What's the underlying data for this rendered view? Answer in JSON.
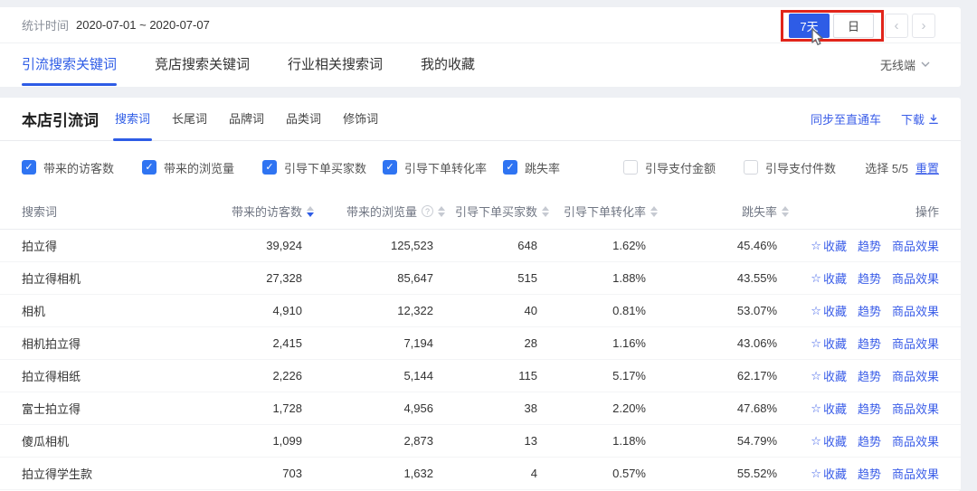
{
  "colors": {
    "accent": "#2e5ce6",
    "link": "#3a5de8",
    "checkbox": "#2f74f2",
    "annotation": "#e1251b"
  },
  "topbar": {
    "stats_label": "统计时间",
    "date_range": "2020-07-01 ~ 2020-07-07",
    "periods": [
      {
        "label": "7天",
        "active": true
      },
      {
        "label": "日",
        "active": false
      }
    ],
    "prev": "‹",
    "next": "›"
  },
  "nav_tabs": {
    "items": [
      {
        "label": "引流搜索关键词",
        "active": true
      },
      {
        "label": "竞店搜索关键词",
        "active": false
      },
      {
        "label": "行业相关搜索词",
        "active": false
      },
      {
        "label": "我的收藏",
        "active": false
      }
    ],
    "channel_label": "无线端"
  },
  "section": {
    "title": "本店引流词",
    "subtabs": [
      {
        "label": "搜索词",
        "active": true
      },
      {
        "label": "长尾词",
        "active": false
      },
      {
        "label": "品牌词",
        "active": false
      },
      {
        "label": "品类词",
        "active": false
      },
      {
        "label": "修饰词",
        "active": false
      }
    ],
    "sync_link": "同步至直通车",
    "download_link": "下载"
  },
  "filters": {
    "items": [
      {
        "label": "带来的访客数",
        "checked": true
      },
      {
        "label": "带来的浏览量",
        "checked": true
      },
      {
        "label": "引导下单买家数",
        "checked": true
      },
      {
        "label": "引导下单转化率",
        "checked": true
      },
      {
        "label": "跳失率",
        "checked": true
      },
      {
        "label": "引导支付金额",
        "checked": false
      },
      {
        "label": "引导支付件数",
        "checked": false
      }
    ],
    "selection_label": "选择 5/5",
    "reset_label": "重置",
    "check_glyph": "✓"
  },
  "table": {
    "columns": [
      {
        "key": "keyword",
        "label": "搜索词",
        "sortable": false
      },
      {
        "key": "visitors",
        "label": "带来的访客数",
        "sortable": true,
        "sort": "desc"
      },
      {
        "key": "views",
        "label": "带来的浏览量",
        "sortable": true,
        "sort": "none",
        "info": true
      },
      {
        "key": "buyers",
        "label": "引导下单买家数",
        "sortable": true,
        "sort": "none"
      },
      {
        "key": "conversion",
        "label": "引导下单转化率",
        "sortable": true,
        "sort": "none"
      },
      {
        "key": "bounce",
        "label": "跳失率",
        "sortable": true,
        "sort": "none"
      },
      {
        "key": "actions",
        "label": "操作",
        "sortable": false
      }
    ],
    "rows": [
      {
        "keyword": "拍立得",
        "visitors": "39,924",
        "views": "125,523",
        "buyers": "648",
        "conversion": "1.62%",
        "bounce": "45.46%"
      },
      {
        "keyword": "拍立得相机",
        "visitors": "27,328",
        "views": "85,647",
        "buyers": "515",
        "conversion": "1.88%",
        "bounce": "43.55%"
      },
      {
        "keyword": "相机",
        "visitors": "4,910",
        "views": "12,322",
        "buyers": "40",
        "conversion": "0.81%",
        "bounce": "53.07%"
      },
      {
        "keyword": "相机拍立得",
        "visitors": "2,415",
        "views": "7,194",
        "buyers": "28",
        "conversion": "1.16%",
        "bounce": "43.06%"
      },
      {
        "keyword": "拍立得相纸",
        "visitors": "2,226",
        "views": "5,144",
        "buyers": "115",
        "conversion": "5.17%",
        "bounce": "62.17%"
      },
      {
        "keyword": "富士拍立得",
        "visitors": "1,728",
        "views": "4,956",
        "buyers": "38",
        "conversion": "2.20%",
        "bounce": "47.68%"
      },
      {
        "keyword": "傻瓜相机",
        "visitors": "1,099",
        "views": "2,873",
        "buyers": "13",
        "conversion": "1.18%",
        "bounce": "54.79%"
      },
      {
        "keyword": "拍立得学生款",
        "visitors": "703",
        "views": "1,632",
        "buyers": "4",
        "conversion": "0.57%",
        "bounce": "55.52%"
      }
    ],
    "row_actions": [
      {
        "label": "收藏",
        "icon": "☆"
      },
      {
        "label": "趋势"
      },
      {
        "label": "商品效果"
      }
    ]
  }
}
